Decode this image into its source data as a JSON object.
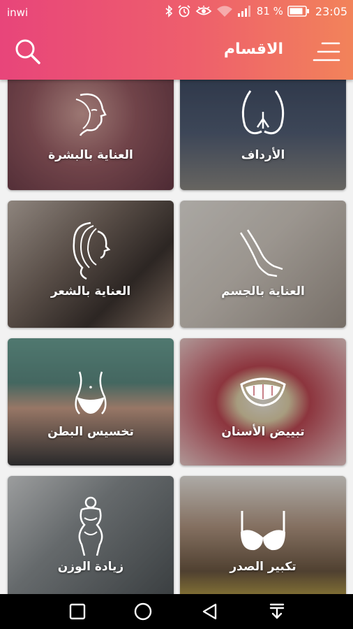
{
  "status_bar": {
    "carrier": "inwi",
    "battery_percent": "81 %",
    "time": "23:05",
    "icons": [
      "bluetooth-icon",
      "alarm-icon",
      "eye-icon",
      "wifi-icon",
      "signal-icon",
      "battery-icon"
    ]
  },
  "app_bar": {
    "title": "الاقسام",
    "search_icon": "search-icon",
    "menu_icon": "menu-icon"
  },
  "categories": [
    {
      "label": "العناية بالبشرة",
      "icon": "face-icon",
      "color": "#8e4e58"
    },
    {
      "label": "الأرداف",
      "icon": "buttocks-icon",
      "color": "#4a5568"
    },
    {
      "label": "العناية بالشعر",
      "icon": "hair-icon",
      "color": "#6b5a52"
    },
    {
      "label": "العناية بالجسم",
      "icon": "legs-icon",
      "color": "#b9b3ae"
    },
    {
      "label": "تخسيس البطن",
      "icon": "waist-icon",
      "color": "#5f8f86"
    },
    {
      "label": "تبييض الأسنان",
      "icon": "smile-icon",
      "color": "#b04b55"
    },
    {
      "label": "زيادة الوزن",
      "icon": "body-icon",
      "color": "#7a7f82"
    },
    {
      "label": "تكبير الصدر",
      "icon": "bra-icon",
      "color": "#8a6f4a"
    }
  ],
  "nav_bar": {
    "icons": [
      "recent-apps-icon",
      "home-icon",
      "back-icon",
      "notification-pull-icon"
    ]
  },
  "colors": {
    "accent_start": "#e8457a",
    "accent_end": "#f2835a"
  }
}
